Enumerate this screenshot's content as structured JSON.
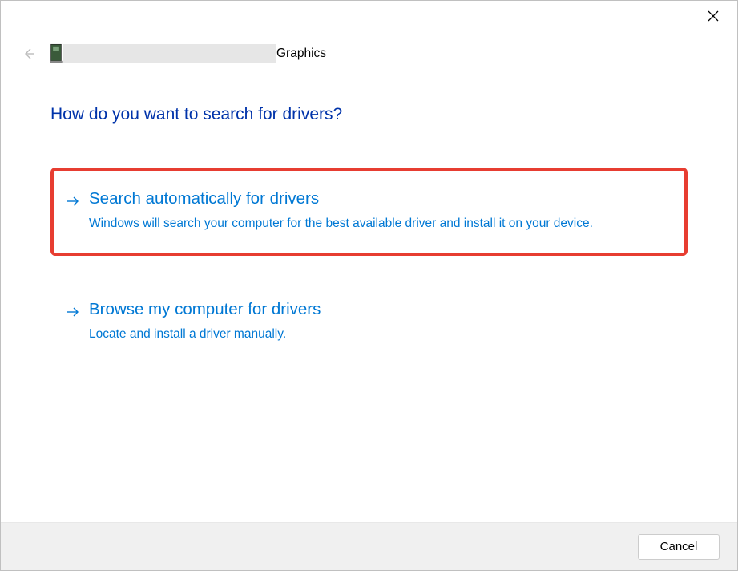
{
  "header": {
    "device_suffix": "Graphics"
  },
  "page": {
    "title": "How do you want to search for drivers?"
  },
  "options": [
    {
      "title": "Search automatically for drivers",
      "description": "Windows will search your computer for the best available driver and install it on your device."
    },
    {
      "title": "Browse my computer for drivers",
      "description": "Locate and install a driver manually."
    }
  ],
  "footer": {
    "cancel_label": "Cancel"
  }
}
